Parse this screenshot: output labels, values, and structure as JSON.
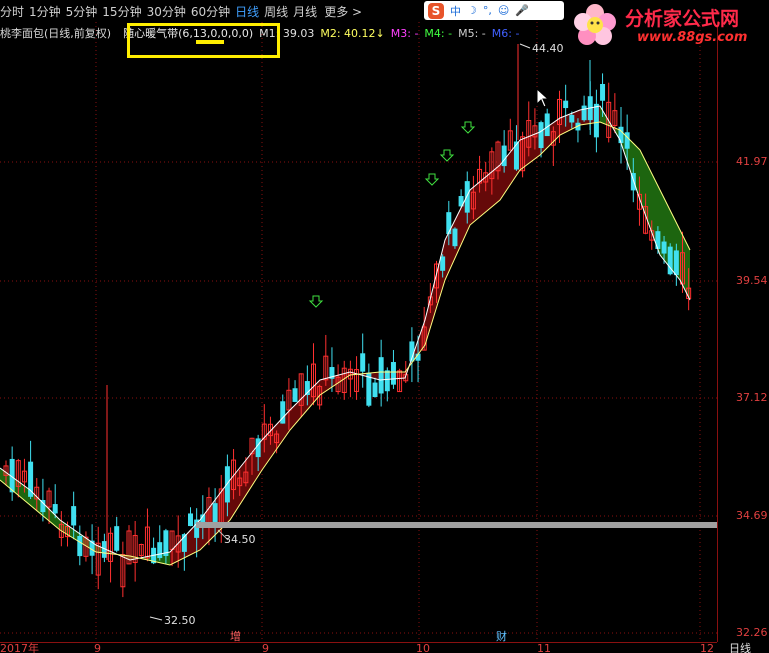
{
  "toolbar": {
    "periods": [
      "分时",
      "1分钟",
      "5分钟",
      "15分钟",
      "30分钟",
      "60分钟",
      "日线",
      "周线",
      "月线"
    ],
    "active_period": "日线",
    "more_label": "更多 >"
  },
  "ime": {
    "mode": "中",
    "icons": [
      "moon-icon",
      "comma-icon",
      "emoji-icon",
      "mic-icon"
    ]
  },
  "watermark": {
    "title": "分析家公式网",
    "url": "www.88gs.com"
  },
  "legend": {
    "stock_title": "桃李面包(日线,前复权)",
    "indicator": "随心暖气带(6,13,0,0,0,0)",
    "m1": "M1: 39.03",
    "m2": "M2: 40.12↓",
    "m3": "M3: -",
    "m4": "M4: -",
    "m5": "M5: -",
    "m6": "M6: -"
  },
  "colors": {
    "up": "#ff3030",
    "down": "#40e0f0",
    "band_up": "#6a0a0a",
    "band_down": "#1f6a10",
    "grid": "#8a1010",
    "ma_fast": "#ffffff",
    "ma_slow": "#ffff80",
    "support": "#a0a0a0",
    "signal": "#40e040"
  },
  "chart_data": {
    "type": "candlestick",
    "y_ticks": [
      "41.97",
      "39.54",
      "37.12",
      "34.69",
      "32.26"
    ],
    "x_labels": [
      "2017年",
      "9",
      "9",
      "10",
      "11",
      "12"
    ],
    "bottom_right_label": "日线",
    "annotations": {
      "high": "44.40",
      "low": "32.50",
      "support": "34.50"
    },
    "event_markers": [
      "增",
      "财"
    ],
    "ylim": [
      32.26,
      44.4
    ]
  }
}
